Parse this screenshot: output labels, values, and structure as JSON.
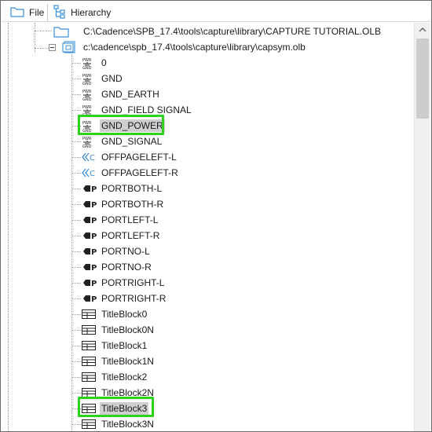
{
  "tabs": [
    {
      "label": "File"
    },
    {
      "label": "Hierarchy"
    }
  ],
  "tree": {
    "library1": {
      "path": "C:\\Cadence\\SPB_17.4\\tools\\capture\\library\\CAPTURE TUTORIAL.OLB"
    },
    "library2": {
      "path": "c:\\cadence\\spb_17.4\\tools\\capture\\library\\capsym.olb"
    },
    "items": [
      {
        "label": "0",
        "icon": "power-symbol-icon"
      },
      {
        "label": "GND",
        "icon": "power-symbol-icon"
      },
      {
        "label": "GND_EARTH",
        "icon": "power-symbol-icon"
      },
      {
        "label": "GND_FIELD SIGNAL",
        "icon": "power-symbol-icon"
      },
      {
        "label": "GND_POWER",
        "icon": "power-symbol-icon",
        "selected": true
      },
      {
        "label": "GND_SIGNAL",
        "icon": "power-symbol-icon"
      },
      {
        "label": "OFFPAGELEFT-L",
        "icon": "offpage-connector-icon"
      },
      {
        "label": "OFFPAGELEFT-R",
        "icon": "offpage-connector-icon"
      },
      {
        "label": "PORTBOTH-L",
        "icon": "port-icon"
      },
      {
        "label": "PORTBOTH-R",
        "icon": "port-icon"
      },
      {
        "label": "PORTLEFT-L",
        "icon": "port-icon"
      },
      {
        "label": "PORTLEFT-R",
        "icon": "port-icon"
      },
      {
        "label": "PORTNO-L",
        "icon": "port-icon"
      },
      {
        "label": "PORTNO-R",
        "icon": "port-icon"
      },
      {
        "label": "PORTRIGHT-L",
        "icon": "port-icon"
      },
      {
        "label": "PORTRIGHT-R",
        "icon": "port-icon"
      },
      {
        "label": "TitleBlock0",
        "icon": "title-block-icon"
      },
      {
        "label": "TitleBlock0N",
        "icon": "title-block-icon"
      },
      {
        "label": "TitleBlock1",
        "icon": "title-block-icon"
      },
      {
        "label": "TitleBlock1N",
        "icon": "title-block-icon"
      },
      {
        "label": "TitleBlock2",
        "icon": "title-block-icon"
      },
      {
        "label": "TitleBlock2N",
        "icon": "title-block-icon"
      },
      {
        "label": "TitleBlock3",
        "icon": "title-block-icon",
        "selected": true
      },
      {
        "label": "TitleBlock3N",
        "icon": "title-block-icon"
      }
    ]
  },
  "colors": {
    "highlight": "#2ed11e",
    "selection": "#cfcfcf",
    "folder_blue": "#3a8fd6"
  }
}
